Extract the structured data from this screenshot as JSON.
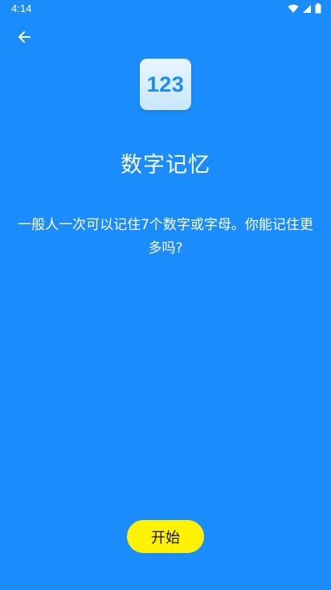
{
  "status_bar": {
    "time": "4:14",
    "icons": [
      "wifi-icon",
      "signal-icon",
      "battery-icon"
    ]
  },
  "header": {
    "back_icon": "arrow-left-icon"
  },
  "app": {
    "icon_text": "123",
    "title": "数字记忆",
    "description": "一般人一次可以记住7个数字或字母。你能记住更多吗?"
  },
  "actions": {
    "start_label": "开始"
  },
  "colors": {
    "background": "#1a8cfb",
    "button": "#fff200",
    "icon_tile": "#d9efff",
    "text": "#ffffff"
  }
}
